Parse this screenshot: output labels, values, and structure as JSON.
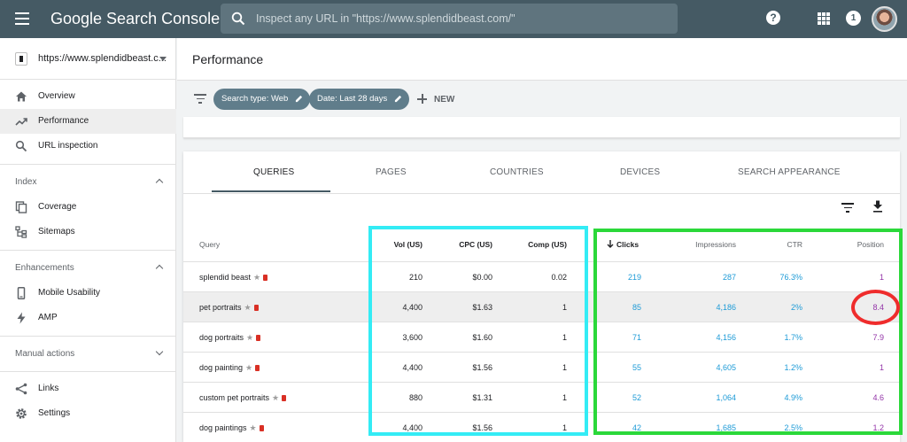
{
  "app": {
    "title": "Google Search Console"
  },
  "search": {
    "placeholder": "Inspect any URL in \"https://www.splendidbeast.com/\""
  },
  "topbar": {
    "notification_count": "1",
    "help": "?"
  },
  "sidebar": {
    "property": "https://www.splendidbeast.c...",
    "items": [
      {
        "label": "Overview"
      },
      {
        "label": "Performance"
      },
      {
        "label": "URL inspection"
      }
    ],
    "sections": [
      {
        "label": "Index",
        "items": [
          {
            "label": "Coverage"
          },
          {
            "label": "Sitemaps"
          }
        ]
      },
      {
        "label": "Enhancements",
        "items": [
          {
            "label": "Mobile Usability"
          },
          {
            "label": "AMP"
          }
        ]
      },
      {
        "label": "Manual actions"
      }
    ],
    "footer": [
      {
        "label": "Links"
      },
      {
        "label": "Settings"
      }
    ]
  },
  "page": {
    "title": "Performance"
  },
  "filters": {
    "chips": [
      {
        "label": "Search type: Web"
      },
      {
        "label": "Date: Last 28 days"
      }
    ],
    "new_label": "NEW"
  },
  "tabs": [
    {
      "label": "QUERIES"
    },
    {
      "label": "PAGES"
    },
    {
      "label": "COUNTRIES"
    },
    {
      "label": "DEVICES"
    },
    {
      "label": "SEARCH APPEARANCE"
    }
  ],
  "table": {
    "headers": {
      "query": "Query",
      "vol": "Vol (US)",
      "cpc": "CPC (US)",
      "comp": "Comp (US)",
      "clicks": "Clicks",
      "impressions": "Impressions",
      "ctr": "CTR",
      "position": "Position"
    },
    "rows": [
      {
        "query": "splendid beast",
        "vol": "210",
        "cpc": "$0.00",
        "comp": "0.02",
        "clicks": "219",
        "impressions": "287",
        "ctr": "76.3%",
        "position": "1"
      },
      {
        "query": "pet portraits",
        "vol": "4,400",
        "cpc": "$1.63",
        "comp": "1",
        "clicks": "85",
        "impressions": "4,186",
        "ctr": "2%",
        "position": "8.4"
      },
      {
        "query": "dog portraits",
        "vol": "3,600",
        "cpc": "$1.60",
        "comp": "1",
        "clicks": "71",
        "impressions": "4,156",
        "ctr": "1.7%",
        "position": "7.9"
      },
      {
        "query": "dog painting",
        "vol": "4,400",
        "cpc": "$1.56",
        "comp": "1",
        "clicks": "55",
        "impressions": "4,605",
        "ctr": "1.2%",
        "position": "1"
      },
      {
        "query": "custom pet portraits",
        "vol": "880",
        "cpc": "$1.31",
        "comp": "1",
        "clicks": "52",
        "impressions": "1,064",
        "ctr": "4.9%",
        "position": "4.6"
      },
      {
        "query": "dog paintings",
        "vol": "4,400",
        "cpc": "$1.56",
        "comp": "1",
        "clicks": "42",
        "impressions": "1,685",
        "ctr": "2.5%",
        "position": "1.2"
      }
    ]
  },
  "colors": {
    "appbar": "#455a64",
    "clicks_impressions": "#1e9bd7",
    "position": "#9334a8",
    "highlight_cyan": "#33ecf5",
    "highlight_green": "#2bd83a",
    "highlight_red": "#ef2c2c"
  }
}
